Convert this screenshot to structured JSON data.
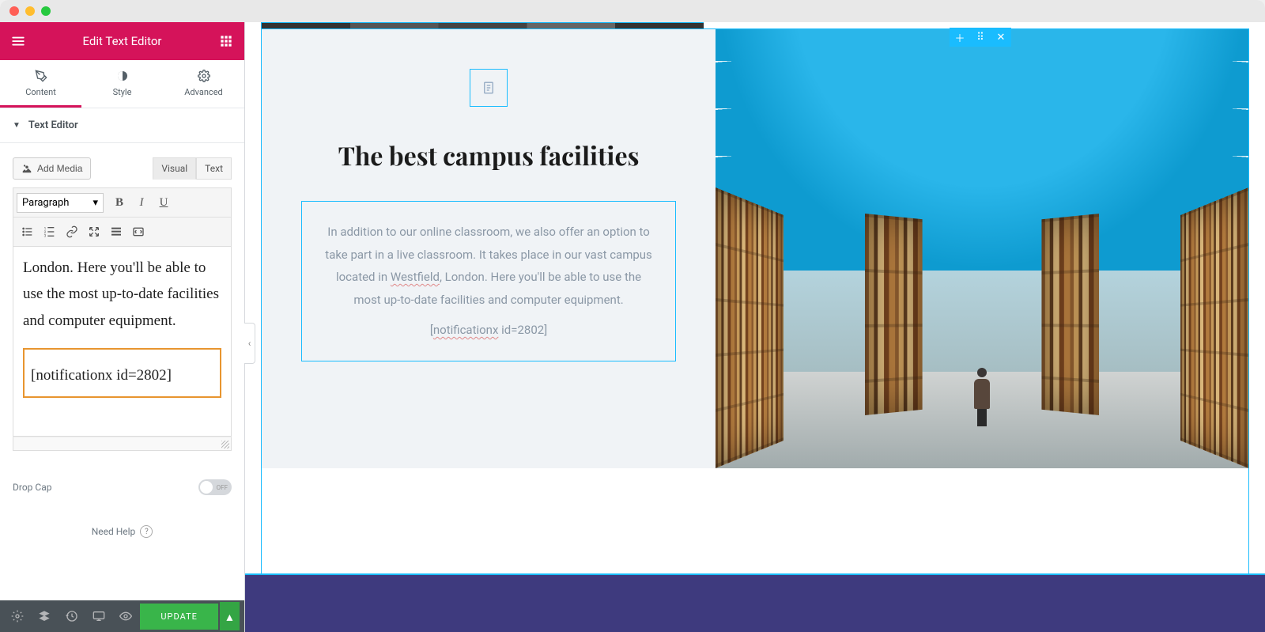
{
  "titlebar": {
    "app": ""
  },
  "sidebar": {
    "title": "Edit Text Editor",
    "tabs": [
      {
        "label": "Content",
        "active": true
      },
      {
        "label": "Style",
        "active": false
      },
      {
        "label": "Advanced",
        "active": false
      }
    ],
    "section_title": "Text Editor",
    "add_media_label": "Add Media",
    "visual_tab": "Visual",
    "text_tab": "Text",
    "para_select": "Paragraph",
    "rte_content_line": "London. Here you'll be able to use the most up-to-date facilities and computer equipment.",
    "rte_shortcode": "[notificationx id=2802]",
    "dropcap_label": "Drop Cap",
    "dropcap_state": "OFF",
    "need_help": "Need Help",
    "update_label": "UPDATE"
  },
  "preview": {
    "heading": "The best campus facilities",
    "paragraph_pre": "In addition to our online classroom, we also offer an option to take part in a live classroom. It takes place in our vast campus located in ",
    "paragraph_link": "Westfield",
    "paragraph_post": ", London. Here you'll be able to use the most up-to-date facilities and computer equipment.",
    "shortcode_label": "notificationx",
    "shortcode_tail": " id=2802]"
  }
}
